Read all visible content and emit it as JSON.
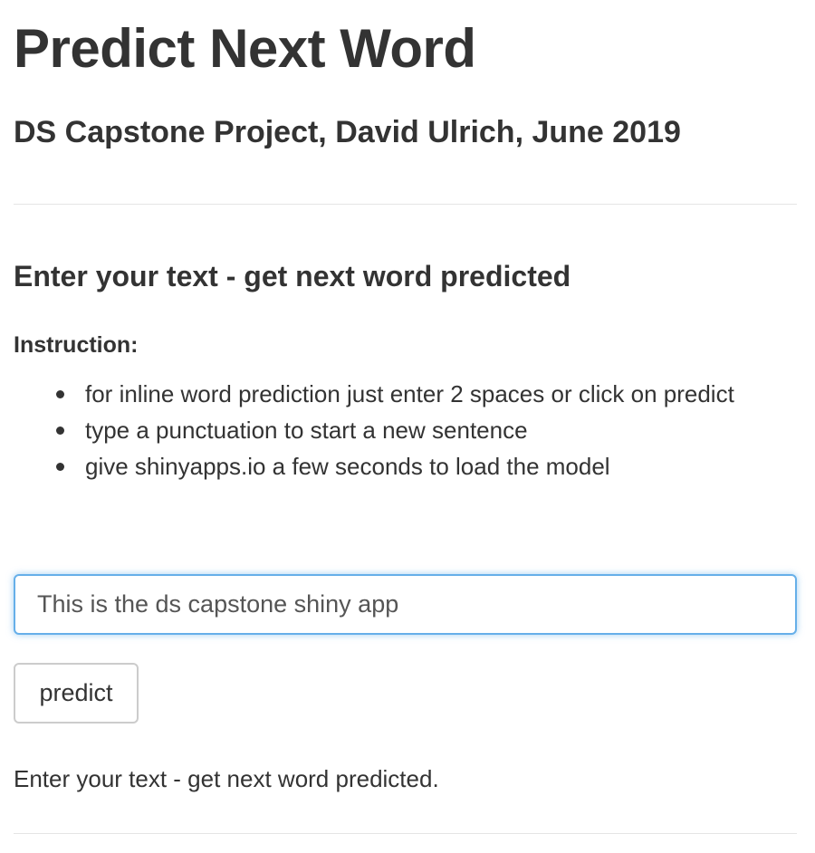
{
  "header": {
    "title": "Predict Next Word",
    "subtitle": "DS Capstone Project, David Ulrich, June 2019"
  },
  "main": {
    "heading": "Enter your text - get next word predicted",
    "instruction_label": "Instruction:",
    "instructions": [
      "for inline word prediction just enter 2 spaces or click on predict",
      "type a punctuation to start a new sentence",
      "give shinyapps.io a few seconds to load the model"
    ],
    "input": {
      "value": "This is the ds capstone shiny app",
      "focus_color": "#66afe9"
    },
    "predict_button_label": "predict",
    "output": "Enter your text - get next word predicted."
  }
}
